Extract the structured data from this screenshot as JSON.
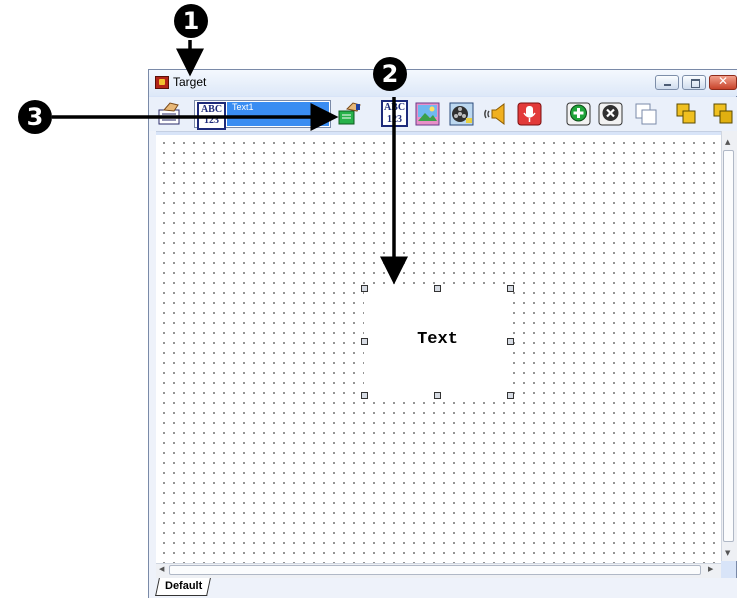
{
  "window": {
    "title": "Target",
    "controls": {
      "minimize": "minimize-button",
      "maximize": "maximize-button",
      "close": "close-button"
    }
  },
  "toolbar": {
    "object_selector": {
      "selected": "Text1"
    },
    "abc_label_top": "ABC",
    "abc_label_bottom": "123",
    "tools": [
      "properties-icon",
      "text-object-icon",
      "object-list",
      "group-icon",
      "insert-text-icon",
      "insert-image-icon",
      "insert-video-icon",
      "insert-sound-icon",
      "insert-record-icon",
      "add-icon",
      "delete-icon",
      "duplicate-icon",
      "bring-forward-icon",
      "send-backward-icon"
    ]
  },
  "canvas": {
    "text_object": {
      "label": "Text"
    }
  },
  "tabs": {
    "active": "Default"
  },
  "annotations": {
    "one": "1",
    "two": "2",
    "three": "3"
  },
  "colors": {
    "selection_blue": "#3a8df2",
    "titlebar": "#dde8f8",
    "arrow": "#000000"
  }
}
